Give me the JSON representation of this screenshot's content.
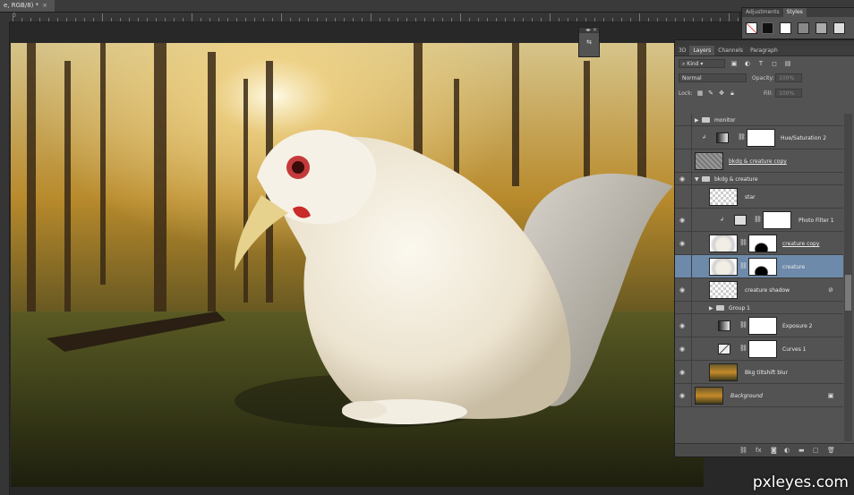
{
  "document": {
    "tab_title": "e, RGB/8) *",
    "tab_close": "×"
  },
  "ruler": {
    "labels": [
      "0"
    ]
  },
  "styles_panel": {
    "tabs": [
      "Adjustments",
      "Styles"
    ],
    "active_tab": "Styles"
  },
  "layers_panel": {
    "tabs": [
      "3D",
      "Layers",
      "Channels",
      "Paragraph"
    ],
    "active_tab": "Layers",
    "filter_kind": "Kind",
    "blend_mode": "Normal",
    "opacity_label": "Opacity:",
    "opacity_value": "100%",
    "lock_label": "Lock:",
    "fill_label": "Fill:",
    "fill_value": "100%",
    "layers": [
      {
        "name": "monitor",
        "kind": "group",
        "indent": 0
      },
      {
        "name": "Hue/Saturation 2",
        "kind": "adjustment",
        "indent": 0
      },
      {
        "name": "bkdg & creature copy",
        "kind": "pixel",
        "indent": 0
      },
      {
        "name": "bkdg & creature",
        "kind": "group-open",
        "indent": 0
      },
      {
        "name": "star",
        "kind": "pixel",
        "indent": 1
      },
      {
        "name": "Photo Filter 1",
        "kind": "adjustment",
        "indent": 1
      },
      {
        "name": "creature copy",
        "kind": "masked",
        "indent": 1
      },
      {
        "name": "creature",
        "kind": "masked",
        "indent": 1,
        "selected": true
      },
      {
        "name": "creature shadow",
        "kind": "pixel",
        "indent": 1
      },
      {
        "name": "Group 1",
        "kind": "group",
        "indent": 1
      },
      {
        "name": "Exposure 2",
        "kind": "adjustment",
        "indent": 1
      },
      {
        "name": "Curves 1",
        "kind": "adjustment",
        "indent": 1
      },
      {
        "name": "Bkg tiltshift blur",
        "kind": "pixel",
        "indent": 0
      },
      {
        "name": "Background",
        "kind": "background",
        "indent": 0
      }
    ],
    "footer_icons": [
      "link-icon",
      "fx-icon",
      "mask-icon",
      "adjustment-icon",
      "folder-icon",
      "new-layer-icon",
      "trash-icon"
    ]
  },
  "watermark": "pxleyes.com"
}
